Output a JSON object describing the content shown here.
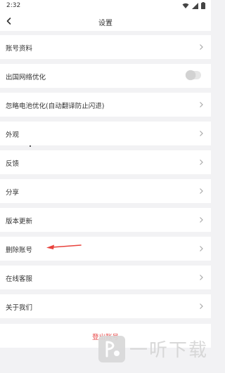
{
  "status_bar": {
    "time": "2:32"
  },
  "header": {
    "title": "设置"
  },
  "rows": [
    {
      "label": "账号资料"
    },
    {
      "label": "出国网络优化"
    },
    {
      "label": "忽略电池优化(自动翻译防止闪退)"
    },
    {
      "label": "外观"
    },
    {
      "label": "反馈"
    },
    {
      "label": "分享"
    },
    {
      "label": "版本更新"
    },
    {
      "label": "删除账号"
    },
    {
      "label": "在线客服"
    },
    {
      "label": "关于我们"
    }
  ],
  "network_toggle": {
    "on": false
  },
  "logout": {
    "label": "登出账号"
  },
  "watermark": {
    "text": "一听下载"
  },
  "colors": {
    "accent_red": "#e8423c",
    "logout_red": "#e84a4a",
    "background": "#f2f2f4",
    "row_bg": "#ffffff"
  }
}
